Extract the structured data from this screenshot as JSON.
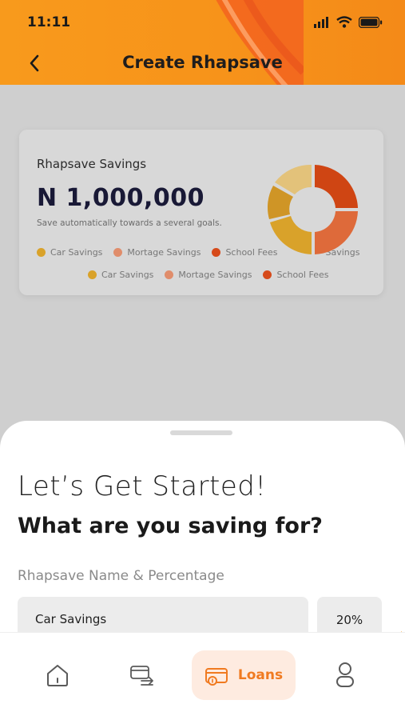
{
  "status_bar": {
    "time": "11:11"
  },
  "header": {
    "title": "Create Rhapsave"
  },
  "savings_card": {
    "label": "Rhapsave Savings",
    "amount": "N 1,000,000",
    "subtitle": "Save automatically towards a several goals.",
    "legend_row1": [
      {
        "label": "Car Savings",
        "color": "#d9a22a"
      },
      {
        "label": "Mortage Savings",
        "color": "#e08d6b"
      },
      {
        "label": "School Fees",
        "color": "#d64a1a"
      },
      {
        "label": "Savings",
        "color": "#d9a22a"
      }
    ],
    "legend_row2": [
      {
        "label": "Car Savings",
        "color": "#d9a22a"
      },
      {
        "label": "Mortage Savings",
        "color": "#e08d6b"
      },
      {
        "label": "School Fees",
        "color": "#d64a1a"
      }
    ]
  },
  "sheet": {
    "greeting": "Let’s Get Started!",
    "question": "What are you saving for?",
    "field_label": "Rhapsave Name & Percentage",
    "name_value": "Car Savings",
    "percent_value": "20%"
  },
  "bottom_nav": {
    "items": [
      {
        "icon": "home-icon",
        "label": ""
      },
      {
        "icon": "transfer-card-icon",
        "label": ""
      },
      {
        "icon": "loans-icon",
        "label": "Loans",
        "active": true
      },
      {
        "icon": "profile-icon",
        "label": ""
      }
    ]
  },
  "colors": {
    "accent": "#f7931a",
    "nav_active_bg": "#feebe0",
    "nav_active_text": "#f07a20"
  }
}
